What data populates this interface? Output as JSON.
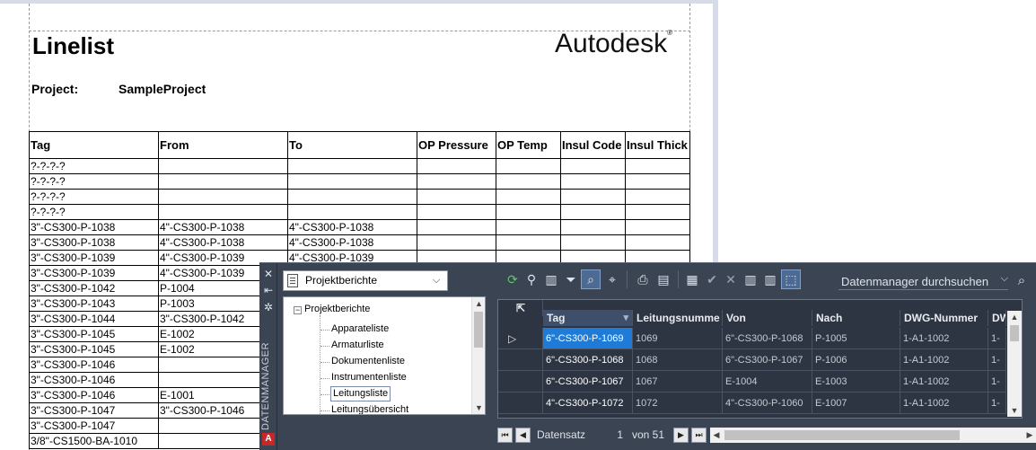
{
  "report": {
    "title": "Linelist",
    "logo": "Autodesk",
    "project_label": "Project:",
    "project_value": "SampleProject",
    "columns": [
      "Tag",
      "From",
      "To",
      "OP Pressure",
      "OP Temp",
      "Insul Code",
      "Insul Thick"
    ],
    "rows": [
      [
        "?-?-?-?",
        "",
        "",
        "",
        "",
        "",
        ""
      ],
      [
        "?-?-?-?",
        "",
        "",
        "",
        "",
        "",
        ""
      ],
      [
        "?-?-?-?",
        "",
        "",
        "",
        "",
        "",
        ""
      ],
      [
        "?-?-?-?",
        "",
        "",
        "",
        "",
        "",
        ""
      ],
      [
        "3\"-CS300-P-1038",
        "4\"-CS300-P-1038",
        "4\"-CS300-P-1038",
        "",
        "",
        "",
        ""
      ],
      [
        "3\"-CS300-P-1038",
        "4\"-CS300-P-1038",
        "4\"-CS300-P-1038",
        "",
        "",
        "",
        ""
      ],
      [
        "3\"-CS300-P-1039",
        "4\"-CS300-P-1039",
        "4\"-CS300-P-1039",
        "",
        "",
        "",
        ""
      ],
      [
        "3\"-CS300-P-1039",
        "4\"-CS300-P-1039",
        "",
        "",
        "",
        "",
        ""
      ],
      [
        "3\"-CS300-P-1042",
        "P-1004",
        "",
        "",
        "",
        "",
        ""
      ],
      [
        "3\"-CS300-P-1043",
        "P-1003",
        "",
        "",
        "",
        "",
        ""
      ],
      [
        "3\"-CS300-P-1044",
        "3\"-CS300-P-1042",
        "",
        "",
        "",
        "",
        ""
      ],
      [
        "3\"-CS300-P-1045",
        "E-1002",
        "",
        "",
        "",
        "",
        ""
      ],
      [
        "3\"-CS300-P-1045",
        "E-1002",
        "",
        "",
        "",
        "",
        ""
      ],
      [
        "3\"-CS300-P-1046",
        "",
        "",
        "",
        "",
        "",
        ""
      ],
      [
        "3\"-CS300-P-1046",
        "",
        "",
        "",
        "",
        "",
        ""
      ],
      [
        "3\"-CS300-P-1046",
        "E-1001",
        "",
        "",
        "",
        "",
        ""
      ],
      [
        "3\"-CS300-P-1047",
        "3\"-CS300-P-1046",
        "",
        "",
        "",
        "",
        ""
      ],
      [
        "3\"-CS300-P-1047",
        "",
        "",
        "",
        "",
        "",
        ""
      ],
      [
        "3/8\"-CS1500-BA-1010",
        "",
        "",
        "",
        "",
        "",
        ""
      ]
    ]
  },
  "datenmanager": {
    "palette_label": "DATENMANAGER",
    "view_select": "Projektberichte",
    "tree": {
      "root": "Projektberichte",
      "items": [
        "Apparateliste",
        "Armaturliste",
        "Dokumentenliste",
        "Instrumentenliste",
        "Leitungsliste",
        "Leitungsübersicht"
      ],
      "selected": "Leitungsliste"
    },
    "search_placeholder": "Datenmanager durchsuchen",
    "grid": {
      "columns": [
        "Tag",
        "Leitungsnumme",
        "Von",
        "Nach",
        "DWG-Nummer",
        "DW"
      ],
      "rows": [
        [
          "6\"-CS300-P-1069",
          "1069",
          "6\"-CS300-P-1068",
          "P-1005",
          "1-A1-1002",
          "1-"
        ],
        [
          "6\"-CS300-P-1068",
          "1068",
          "6\"-CS300-P-1067",
          "P-1006",
          "1-A1-1002",
          "1-"
        ],
        [
          "6\"-CS300-P-1067",
          "1067",
          "E-1004",
          "E-1003",
          "1-A1-1002",
          "1-"
        ],
        [
          "4\"-CS300-P-1072",
          "1072",
          "4\"-CS300-P-1060",
          "E-1007",
          "1-A1-1002",
          "1-"
        ]
      ]
    },
    "nav": {
      "label": "Datensatz",
      "current": "1",
      "of_text": "von 51"
    }
  }
}
